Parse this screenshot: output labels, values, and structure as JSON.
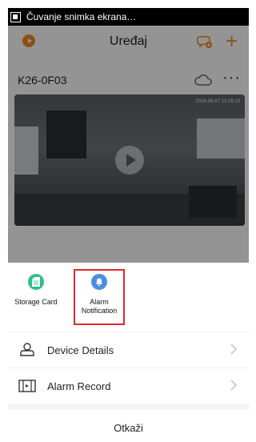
{
  "status_bar": {
    "notification_text": "Čuvanje snimka ekrana…",
    "icon": "screenshot-icon"
  },
  "header": {
    "title": "Uređaj",
    "left_icon": "record-icon",
    "chat_icon": "chat-add-icon",
    "add_label": "+"
  },
  "device": {
    "name": "K26-0F03",
    "cloud_icon": "cloud-icon",
    "more_label": "···",
    "timestamp": "2019-06-07 13:29:19",
    "play_icon": "play-icon"
  },
  "sheet": {
    "shortcuts": [
      {
        "label": "Storage Card",
        "icon": "sd-card-icon",
        "color": "#2bbf8a"
      },
      {
        "label": "Alarm Notification",
        "icon": "alarm-notification-icon",
        "color": "#4a90e2",
        "highlighted": true
      }
    ],
    "items": [
      {
        "label": "Device Details",
        "icon": "device-details-icon"
      },
      {
        "label": "Alarm Record",
        "icon": "alarm-record-icon"
      }
    ],
    "cancel_label": "Otkaži"
  },
  "colors": {
    "accent": "#f08a24",
    "highlight": "#e0282f"
  }
}
